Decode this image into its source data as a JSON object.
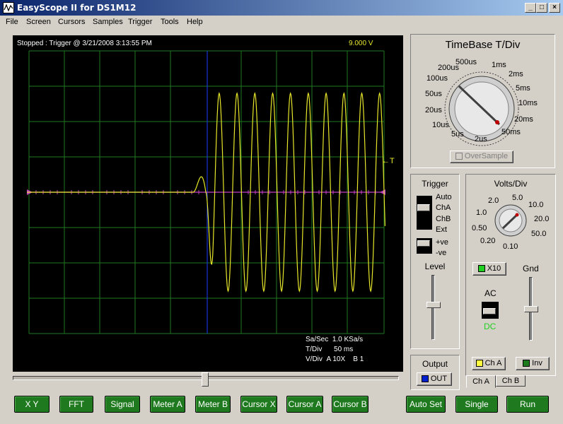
{
  "window": {
    "title": "EasyScope II for DS1M12",
    "buttons": {
      "minimize": "_",
      "maximize": "□",
      "close": "×"
    }
  },
  "menu": [
    "File",
    "Screen",
    "Cursors",
    "Samples",
    "Trigger",
    "Tools",
    "Help"
  ],
  "scope": {
    "status": "Stopped : Trigger @ 3/21/2008 3:13:55 PM",
    "voltage_readout": "9.000  V",
    "trigger_marker": "←T",
    "info": {
      "sa_sec_label": "Sa/Sec",
      "sa_sec_value": "1.0 KSa/s",
      "tdiv_label": "T/Div",
      "tdiv_value": "50 ms",
      "vdiv_label": "V/Div",
      "vdiv_a": "A 10X",
      "vdiv_b": "B 1"
    },
    "colors": {
      "grid": "#1f7a1f",
      "trace": "#e6e62a",
      "cursor": "#1a3cff",
      "center": "#c040c0"
    }
  },
  "timebase": {
    "title": "TimeBase T/Div",
    "labels": [
      "500us",
      "1ms",
      "2ms",
      "5ms",
      "10ms",
      "20ms",
      "50ms",
      "2us",
      "5us",
      "10us",
      "20us",
      "50us",
      "100us",
      "200us"
    ],
    "selected": "50ms",
    "oversample_label": "OverSample"
  },
  "trigger": {
    "title": "Trigger",
    "sources": [
      "Auto",
      "ChA",
      "ChB",
      "Ext"
    ],
    "slope": [
      "+ve",
      "-ve"
    ],
    "level_label": "Level"
  },
  "volts": {
    "title": "Volts/Div",
    "labels": [
      "2.0",
      "5.0",
      "10.0",
      "1.0",
      "20.0",
      "0.50",
      "50.0",
      "0.20",
      "0.10"
    ],
    "x10_label": "X10",
    "gnd_label": "Gnd",
    "ac_label": "AC",
    "dc_label": "DC",
    "cha_label": "Ch A",
    "inv_label": "Inv",
    "tabs": [
      "Ch A",
      "Ch B"
    ]
  },
  "output": {
    "title": "Output",
    "out_label": "OUT"
  },
  "bottom_buttons": [
    "X Y",
    "FFT",
    "Signal",
    "Meter A",
    "Meter B",
    "Cursor X",
    "Cursor A",
    "Cursor B",
    "Auto Set",
    "Single",
    "Run"
  ]
}
